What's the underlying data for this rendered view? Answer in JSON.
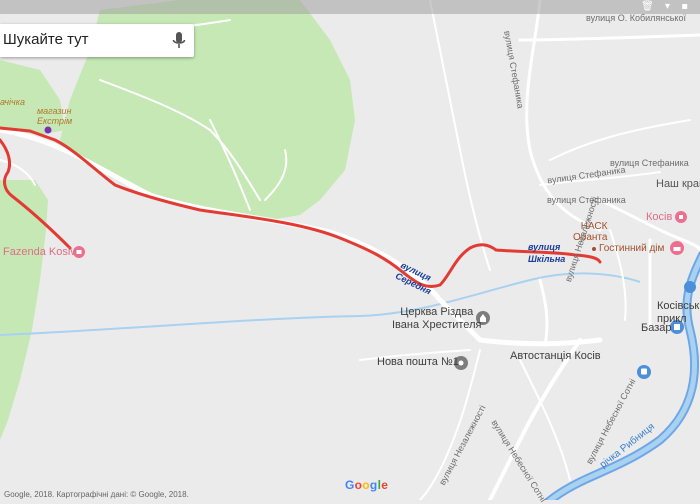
{
  "search": {
    "placeholder": "Шукайте тут"
  },
  "status_icons": "🗑 ▾ ▪",
  "labels": {
    "vul_kobylianskoi": "вулиця О. Кобилянської",
    "vul_stefanyka_vertical": "вулиця Стефаника",
    "vul_stefanyka_right": "вулиця Стефаника",
    "vul_stefanyka_low": "вулиця Стефаника",
    "vul_stefanyka_low2": "вулиця Стефаника",
    "nash_krai": "Наш край",
    "kosiv": "Косів",
    "nask_oranta": "НАСК\nОранта",
    "hostynnyi_dim": "Гостинний дім",
    "vul_shkilna": "вулиця\nШкільна",
    "vul_seredna": "вулиця\nСередня",
    "tserkva": "Церква Різдва\nІвана Хрестителя",
    "nova_poshta": "Нова пошта №1",
    "bazar": "Базар",
    "avtostantsiia": "Автостанція Косів",
    "kosivski_prykl": "Косівські\nприкл",
    "richka": "річка Рибниця",
    "vul_nezalezhnosti_1": "вулиця Незалежності",
    "vul_nezalezhnosti_2": "вулиця Незалежності",
    "vul_nebesnoi_1": "вулиця Небесної Сотні",
    "vul_nebesnoi_2": "вулиця Небесної Сотні",
    "fazenda": "Fazenda Kosiv",
    "magazyn": "магазин\nЕкстрім",
    "partial_label": "ачічка",
    "copyright": "Google, 2018. Картографічні дані: © Google, 2018.",
    "google": "Google"
  },
  "colors": {
    "background": "#ebebeb",
    "park": "#c5e8b5",
    "road": "#ffffff",
    "route": "#e23b34",
    "water": "#a8d2f0",
    "river": "#4b8fe0",
    "marker_gray": "#7d7d7d",
    "marker_pink": "#ec6f8f",
    "marker_blue": "#4d8fd8",
    "marker_purple": "#7a2fb4"
  },
  "icons": [
    "mic-icon",
    "church-icon",
    "post-office-icon",
    "bazar-icon",
    "bus-station-icon",
    "hotel-icon",
    "pink-pin-icon",
    "purple-dot-icon"
  ]
}
